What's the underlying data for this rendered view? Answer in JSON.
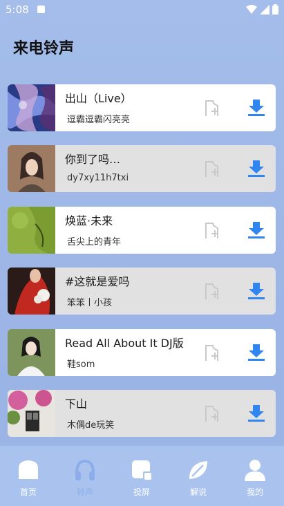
{
  "status": {
    "time": "5:08"
  },
  "page": {
    "title": "来电铃声"
  },
  "songs": [
    {
      "title": "出山（Live）",
      "artist": "逗霸逗霸闪亮亮"
    },
    {
      "title": "你到了吗…",
      "artist": "dy7xy11h7txi"
    },
    {
      "title": "焕蓝·未来",
      "artist": "舌尖上的青年"
    },
    {
      "title": "#这就是爱吗",
      "artist": "笨笨丨小孩"
    },
    {
      "title": "Read All About It   DJ版",
      "artist": "鞋som"
    },
    {
      "title": "下山",
      "artist": "木偶de玩笑"
    }
  ],
  "nav": [
    {
      "label": "首页",
      "icon": "home-icon"
    },
    {
      "label": "铃声",
      "icon": "headphones-icon"
    },
    {
      "label": "投屏",
      "icon": "cast-screen-icon"
    },
    {
      "label": "解说",
      "icon": "leaf-icon"
    },
    {
      "label": "我的",
      "icon": "user-icon"
    }
  ],
  "colors": {
    "accent": "#2f86f0",
    "background": "#a0b9e8",
    "nav_bar": "#a9c3ee"
  }
}
